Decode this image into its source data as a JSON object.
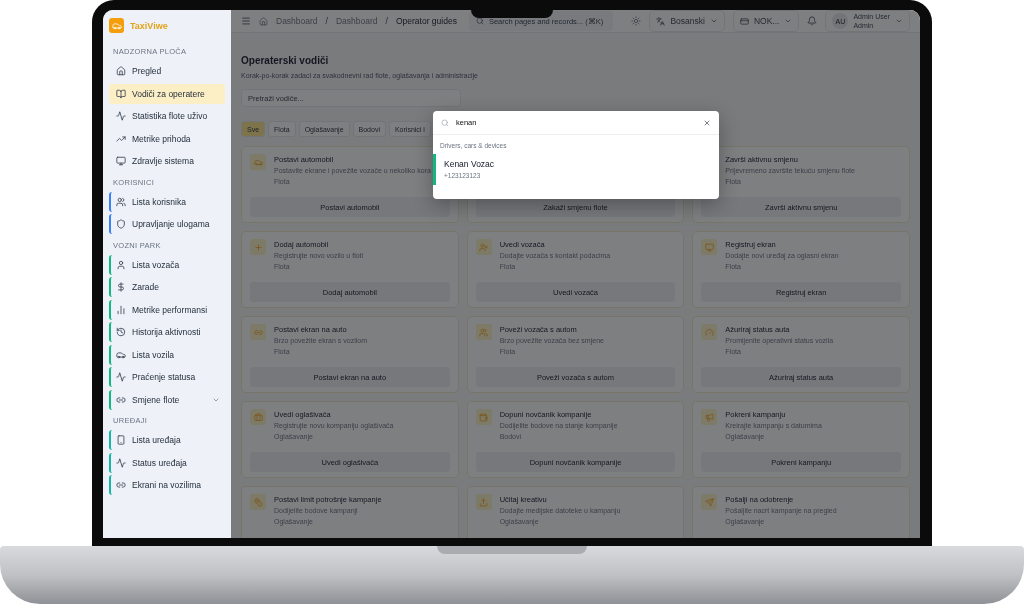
{
  "sidebar": {
    "brand": "TaxiViwe",
    "groups": [
      {
        "title": "NADZORNA PLOČA",
        "items": [
          {
            "label": "Pregled",
            "selected": false
          },
          {
            "label": "Vodiči za operatere",
            "selected": true
          },
          {
            "label": "Statistika flote uživo",
            "selected": false
          },
          {
            "label": "Metrike prihoda",
            "selected": false
          },
          {
            "label": "Zdravlje sistema",
            "selected": false
          }
        ]
      },
      {
        "title": "KORISNICI",
        "color": "#3b82f6",
        "items": [
          {
            "label": "Lista korisnika",
            "selected": false
          },
          {
            "label": "Upravljanje ulogama",
            "selected": false
          }
        ]
      },
      {
        "title": "VOZNI PARK",
        "color": "#10b981",
        "items": [
          {
            "label": "Lista vozača",
            "selected": false
          },
          {
            "label": "Zarade",
            "selected": false
          },
          {
            "label": "Metrike performansi",
            "selected": false
          },
          {
            "label": "Historija aktivnosti",
            "selected": false
          },
          {
            "label": "Lista vozila",
            "selected": false
          },
          {
            "label": "Praćenje statusa",
            "selected": false
          },
          {
            "label": "Smjene flote",
            "selected": false,
            "expanded": false
          }
        ]
      },
      {
        "title": "UREĐAJI",
        "color": "#14b8a6",
        "items": [
          {
            "label": "Lista uređaja",
            "selected": false
          },
          {
            "label": "Status uređaja",
            "selected": false
          },
          {
            "label": "Ekrani na vozilima",
            "selected": false
          }
        ]
      }
    ]
  },
  "topbar": {
    "breadcrumb": [
      "Dashboard",
      "Dashboard",
      "Operator guides"
    ],
    "breadcrumb_separator": "/",
    "search_placeholder": "Search pages and records... (⌘K)",
    "language": "Bosanski",
    "company": "NOK...",
    "user_initials": "AU",
    "user_name": "Admin User",
    "user_role": "Admin"
  },
  "page": {
    "title": "Operaterski vodiči",
    "subtitle": "Korak-po-korak zadaci za svakodnevni rad flote, oglašavanja i administracije",
    "search_placeholder": "Pretraži vodiče...",
    "filters": [
      {
        "label": "Sve",
        "selected": true
      },
      {
        "label": "Flota",
        "selected": false
      },
      {
        "label": "Oglašavanje",
        "selected": false
      },
      {
        "label": "Bodovi",
        "selected": false
      },
      {
        "label": "Korisnici i",
        "selected": false
      }
    ],
    "cards": [
      {
        "title": "Postavi automobil",
        "description": "Postavite ekrane i povežite vozače u nekoliko kora",
        "category": "Flota",
        "action": "Postavi automobil"
      },
      {
        "action": "Zakaži smjenu flote"
      },
      {
        "title": "Završi aktivnu smjenu",
        "description": "Prijevremeno završite tekuću smjenu flote",
        "category": "Flota",
        "action": "Završi aktivnu smjenu"
      },
      {
        "title": "Dodaj automobil",
        "description": "Registrujte novo vozilo u floti",
        "category": "Flota",
        "action": "Dodaj automobil"
      },
      {
        "title": "Uvedi vozača",
        "description": "Dodajte vozača s kontakt podacima",
        "category": "Flota",
        "action": "Uvedi vozača"
      },
      {
        "title": "Registruj ekran",
        "description": "Dodajte novi uređaj za oglasni ekran",
        "category": "Flota",
        "action": "Registruj ekran"
      },
      {
        "title": "Postavi ekran na auto",
        "description": "Brzo povežite ekran s vozilom",
        "category": "Flota",
        "action": "Postavi ekran na auto"
      },
      {
        "title": "Poveži vozača s autom",
        "description": "Brzo povežite vozača bez smjene",
        "category": "Flota",
        "action": "Poveži vozača s autom"
      },
      {
        "title": "Ažuriraj status auta",
        "description": "Promijenite operativni status vozila",
        "category": "Flota",
        "action": "Ažuriraj status auta"
      },
      {
        "title": "Uvedi oglašivača",
        "description": "Registrujte novu kompaniju oglašivača",
        "category": "Oglašavanje",
        "action": "Uvedi oglašivača"
      },
      {
        "title": "Dopuni novčanik kompanije",
        "description": "Dodijelite bodove na stanje kompanije",
        "category": "Bodovi",
        "action": "Dopuni novčanik kompanije"
      },
      {
        "title": "Pokreni kampanju",
        "description": "Kreirajte kampanju s datumima",
        "category": "Oglašavanje",
        "action": "Pokreni kampanju"
      },
      {
        "title": "Postavi limit potrošnje kampanje",
        "description": "Dodijelite bodove kampanji",
        "category": "Oglašavanje"
      },
      {
        "title": "Učitaj kreativu",
        "description": "Dodajte medijske datoteke u kampanju",
        "category": "Oglašavanje"
      },
      {
        "title": "Pošalji na odobrenje",
        "description": "Pošaljite nacrt kampanje na pregled",
        "category": "Oglašavanje"
      }
    ]
  },
  "search_dialog": {
    "query": "kenan",
    "section": "Drivers, cars & devices",
    "results": [
      {
        "name": "Kenan Vozac",
        "phone": "+123123123",
        "selected": true
      }
    ]
  }
}
